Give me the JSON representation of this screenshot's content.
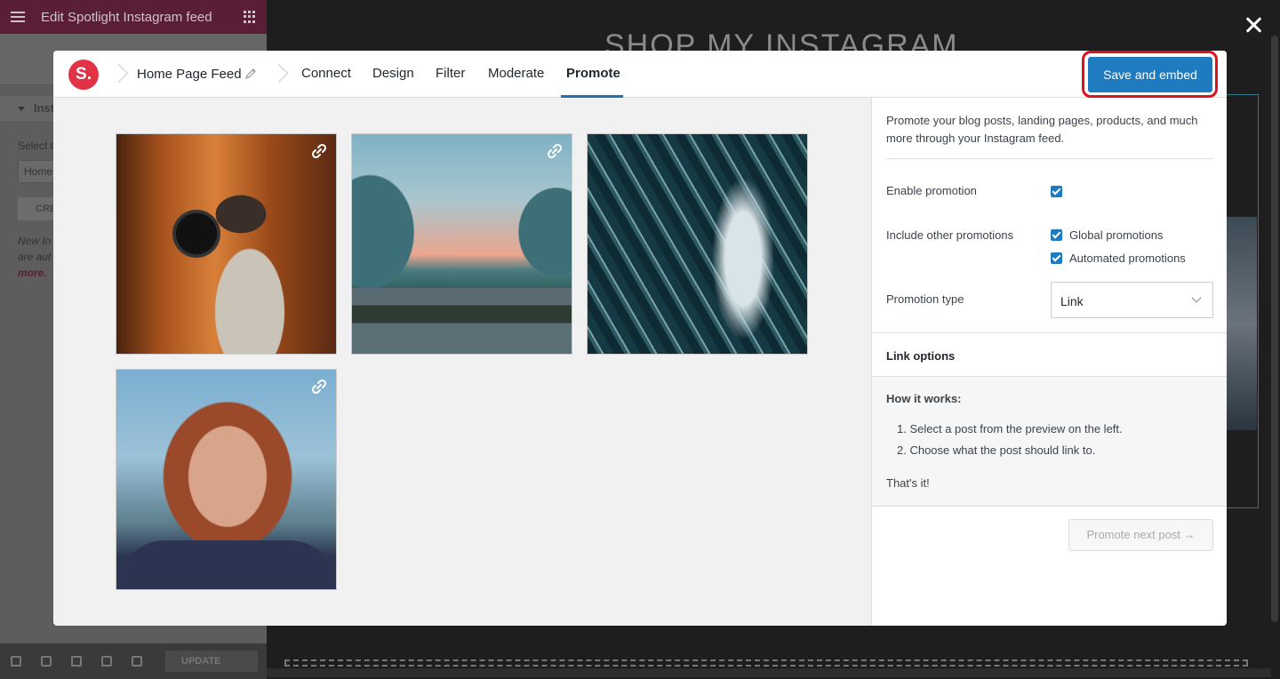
{
  "editor": {
    "title": "Edit Spotlight Instagram feed",
    "section_label": "Inst",
    "select_label": "Select t",
    "select_value": "Home",
    "create_label": "CRE",
    "note_text": "New In",
    "note_text2": "are aut",
    "note_link": "more.",
    "update_label": "UPDATE"
  },
  "preview": {
    "heading": "SHOP MY INSTAGRAM"
  },
  "modal": {
    "logo_text": "S.",
    "feed_name": "Home Page Feed",
    "tabs": [
      {
        "label": "Connect"
      },
      {
        "label": "Design"
      },
      {
        "label": "Filter"
      },
      {
        "label": "Moderate"
      },
      {
        "label": "Promote"
      }
    ],
    "active_tab": "Promote",
    "save_button": "Save and embed",
    "accent_color": "#1e7bc0",
    "highlight_color": "#e2101a"
  },
  "posts": [
    {
      "subject": "person tossing camera in autumn forest",
      "has_link": true
    },
    {
      "subject": "mountain valley river at sunset",
      "has_link": true
    },
    {
      "subject": "aerial ocean waves",
      "has_link": false
    },
    {
      "subject": "portrait of red-haired woman",
      "has_link": true
    }
  ],
  "panel": {
    "intro": "Promote your blog posts, landing pages, products, and much more through your Instagram feed.",
    "enable_label": "Enable promotion",
    "enable_checked": true,
    "include_label": "Include other promotions",
    "global_label": "Global promotions",
    "global_checked": true,
    "automated_label": "Automated promotions",
    "automated_checked": true,
    "type_label": "Promotion type",
    "type_value": "Link",
    "link_options": "Link options",
    "howto_title": "How it works:",
    "steps": [
      "1. Select a post from the preview on the left.",
      "2. Choose what the post should link to."
    ],
    "howto_end": "That's it!",
    "next_button": "Promote next post →"
  }
}
